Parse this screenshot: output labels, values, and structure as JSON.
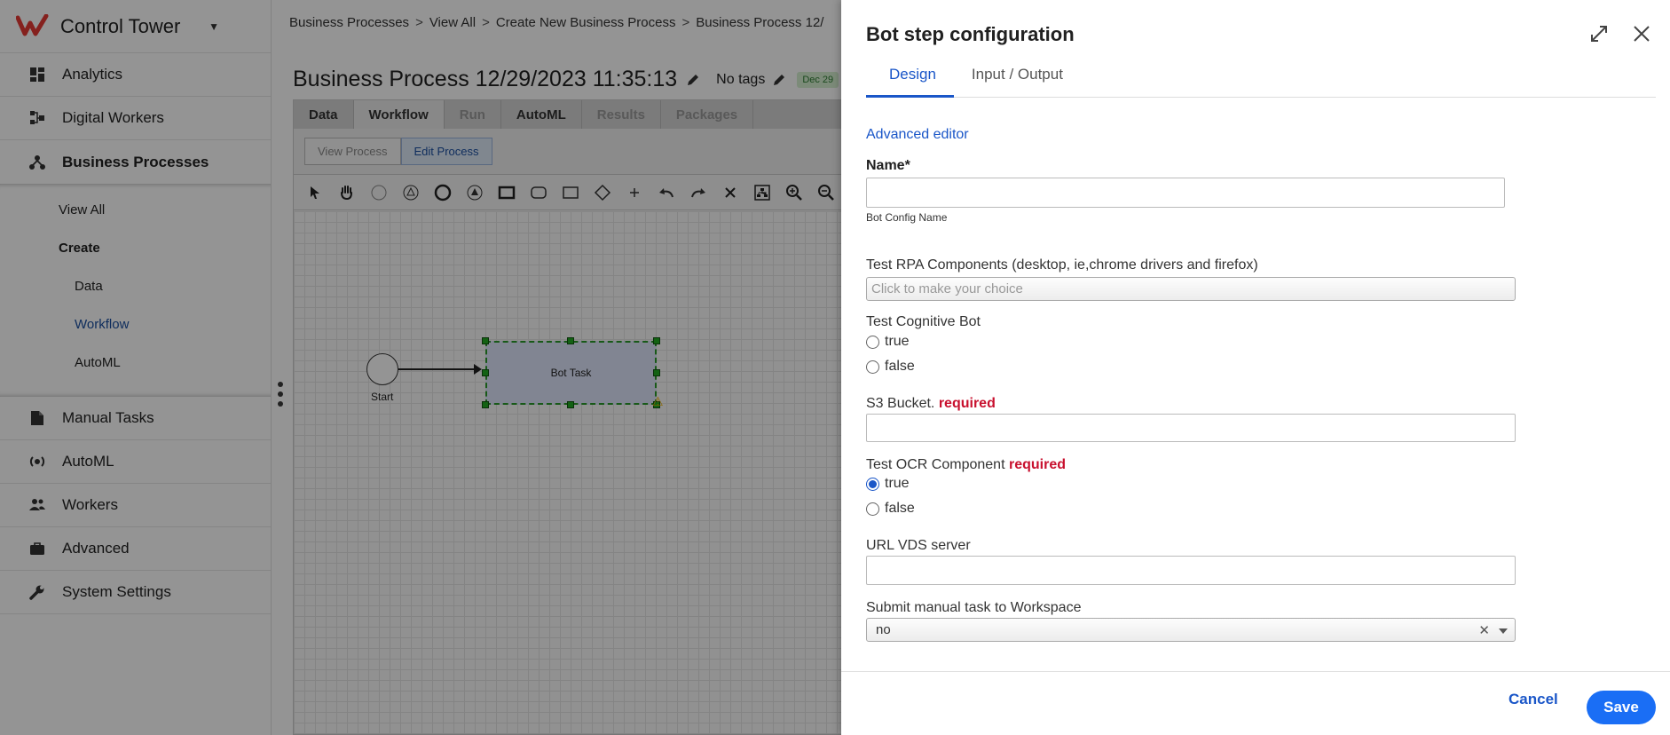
{
  "app": {
    "name": "Control Tower"
  },
  "sidebar": {
    "items": [
      {
        "label": "Analytics",
        "icon": "dashboard-icon"
      },
      {
        "label": "Digital Workers",
        "icon": "hierarchy-icon"
      },
      {
        "label": "Business Processes",
        "icon": "process-icon"
      },
      {
        "label": "Manual Tasks",
        "icon": "document-icon"
      },
      {
        "label": "AutoML",
        "icon": "automl-icon"
      },
      {
        "label": "Workers",
        "icon": "people-icon"
      },
      {
        "label": "Advanced",
        "icon": "briefcase-icon"
      },
      {
        "label": "System Settings",
        "icon": "wrench-icon"
      }
    ],
    "subitems": {
      "view_all": "View All",
      "create": "Create",
      "data": "Data",
      "workflow": "Workflow",
      "automl": "AutoML"
    }
  },
  "breadcrumb": [
    "Business Processes",
    "View All",
    "Create New Business Process",
    "Business Process 12/"
  ],
  "process": {
    "title": "Business Process 12/29/2023 11:35:13",
    "tags": "No tags",
    "date_chip": "Dec 29"
  },
  "workflow_tabs": [
    "Data",
    "Workflow",
    "Run",
    "AutoML",
    "Results",
    "Packages"
  ],
  "mode_buttons": {
    "view": "View Process",
    "edit": "Edit Process"
  },
  "canvas": {
    "start_label": "Start",
    "task_label": "Bot Task"
  },
  "dialog": {
    "title": "Bot step configuration",
    "tabs": {
      "design": "Design",
      "io": "Input / Output"
    },
    "advanced_editor": "Advanced editor",
    "name_label": "Name*",
    "name_value": "",
    "name_help": "Bot Config Name",
    "rpa_label": "Test RPA Components (desktop, ie,chrome drivers and firefox)",
    "rpa_placeholder": "Click to make your choice",
    "cognitive_label": "Test Cognitive Bot",
    "cognitive_true": "true",
    "cognitive_false": "false",
    "s3_label": "S3 Bucket.",
    "required_text": "required",
    "s3_value": "",
    "ocr_label": "Test OCR Component",
    "ocr_true": "true",
    "ocr_false": "false",
    "vds_label": "URL VDS server",
    "vds_value": "",
    "workspace_label": "Submit manual task to Workspace",
    "workspace_value": "no",
    "cancel": "Cancel",
    "save": "Save"
  },
  "colors": {
    "accent": "#1a56c8",
    "save_button": "#1a6ef5",
    "required": "#c8102e",
    "logo": "#e53935"
  }
}
